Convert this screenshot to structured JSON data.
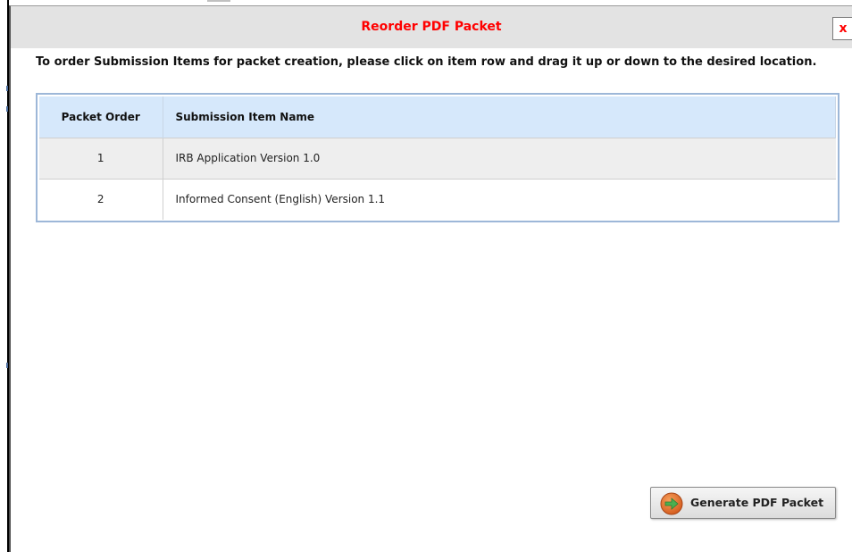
{
  "dialog": {
    "title": "Reorder PDF Packet",
    "close_label": "x",
    "instructions": "To order Submission Items for packet creation, please click on item row and drag it up or down to the desired location."
  },
  "grid": {
    "columns": [
      "Packet Order",
      "Submission Item Name"
    ],
    "rows": [
      {
        "order": "1",
        "name": "IRB Application Version 1.0"
      },
      {
        "order": "2",
        "name": "Informed Consent (English) Version 1.1"
      }
    ]
  },
  "actions": {
    "generate_label": "Generate PDF Packet",
    "generate_icon": "arrow-right-circle-icon"
  },
  "colors": {
    "title_text": "#ff0000",
    "header_bg": "#d6e8fb",
    "grid_border": "#9db7d8",
    "icon_orange": "#e8732a",
    "icon_green": "#4caf50"
  }
}
